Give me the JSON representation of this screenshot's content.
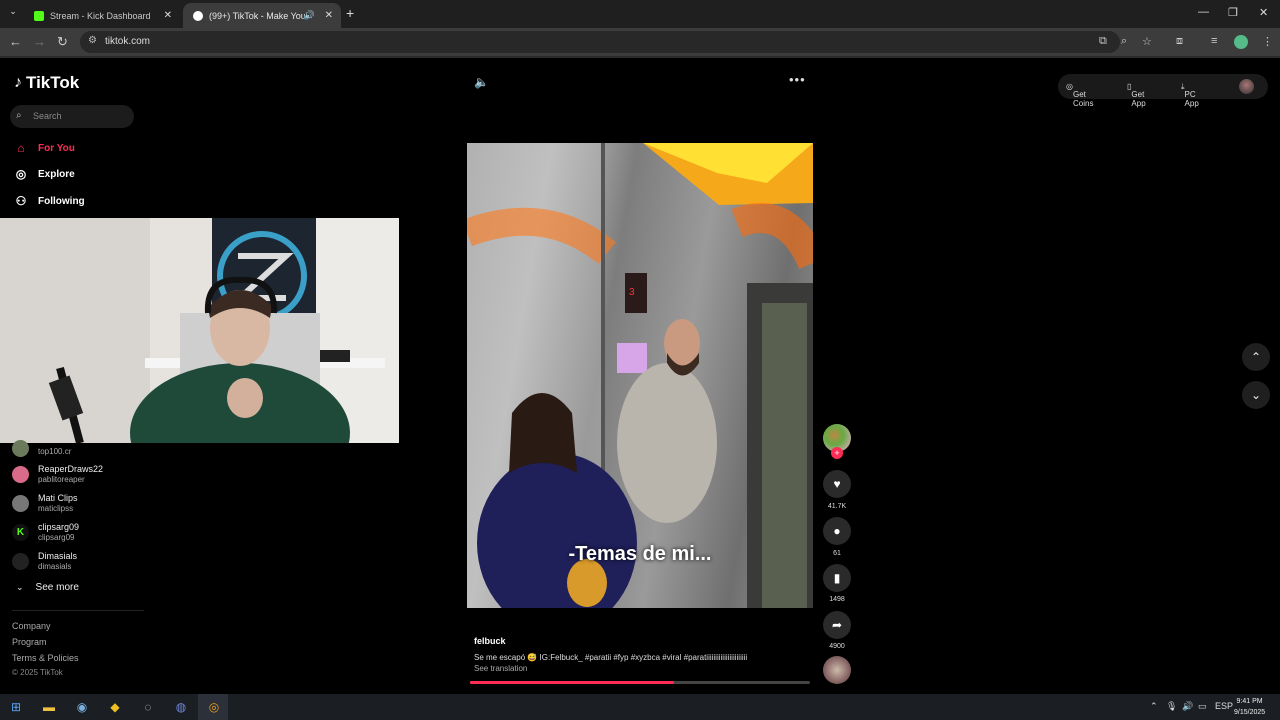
{
  "browser": {
    "tabs": [
      {
        "label": "Stream - Kick Dashboard",
        "favicon_color": "#53fc18"
      },
      {
        "label": "(99+) TikTok - Make Your Day",
        "favicon_color": "#ffffff",
        "active": true
      }
    ],
    "url": "tiktok.com"
  },
  "sidebar": {
    "logo": "TikTok",
    "search_placeholder": "Search",
    "nav": [
      {
        "label": "For You",
        "icon": "home-icon",
        "active": true
      },
      {
        "label": "Explore",
        "icon": "compass-icon"
      },
      {
        "label": "Following",
        "icon": "user-follow-icon"
      }
    ],
    "following": [
      {
        "name": "",
        "handle": "top100.cr",
        "avatar_color": "#6a7a5a"
      },
      {
        "name": "ReaperDraws22",
        "handle": "pablitoreaper",
        "avatar_color": "#d86a8a"
      },
      {
        "name": "Mati Clips",
        "handle": "maticlipss",
        "avatar_color": "#777"
      },
      {
        "name": "clipsarg09",
        "handle": "clipsarg09",
        "avatar_color": "#1a1a1a"
      },
      {
        "name": "Dimasials",
        "handle": "dimasials",
        "avatar_color": "#222"
      }
    ],
    "see_more": "See more",
    "footer": [
      "Company",
      "Program",
      "Terms & Policies",
      "© 2025 TikTok"
    ]
  },
  "topbar": {
    "get_coins": "Get Coins",
    "get_app": "Get App",
    "pc_app": "PC App"
  },
  "video": {
    "overlay_caption": "-Temas de mi...",
    "author": "felbuck",
    "description": "Se me escapó 😅 IG:Felbuck_ #paratii #fyp #xyzbca #viral #paratiiiiiiiiiiiiiiiiiiiiiii",
    "see_translation": "See translation",
    "progress": 0.6
  },
  "actions": {
    "likes": "41.7K",
    "comments": "61",
    "saves": "1498",
    "shares": "4900"
  },
  "taskbar": {
    "language": "ESP",
    "time": "9:41 PM",
    "date": "9/15/2025"
  },
  "colors": {
    "accent": "#fe2c55",
    "kick": "#53fc18"
  }
}
